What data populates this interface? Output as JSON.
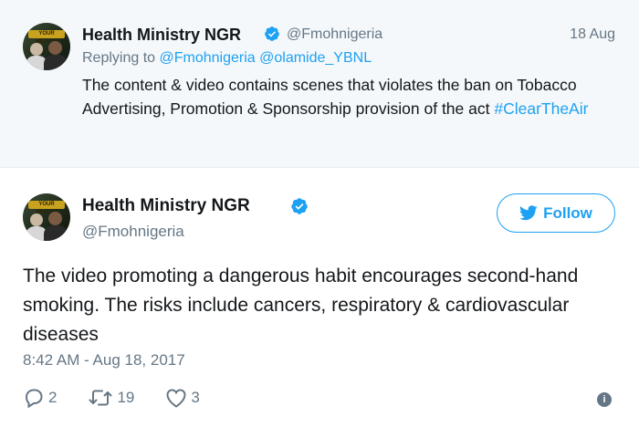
{
  "parent_tweet": {
    "avatar_alt": "Health Ministry NGR avatar",
    "avatar_banner_text": "YOUR HEALTH",
    "name": "Health Ministry NGR",
    "handle": "@Fmohnigeria",
    "date": "18 Aug",
    "replying_label": "Replying to",
    "replying_to": [
      "@Fmohnigeria",
      "@olamide_YBNL"
    ],
    "text_before_tag": "The content & video contains scenes that violates the ban on Tobacco Advertising, Promotion & Sponsorship provision of the act ",
    "hashtag": "#ClearTheAir"
  },
  "main_tweet": {
    "name": "Health Ministry NGR",
    "handle": "@Fmohnigeria",
    "follow_label": "Follow",
    "text": "The video promoting a dangerous habit encourages second-hand smoking. The risks include cancers, respiratory & cardiovascular diseases",
    "timestamp": "8:42 AM - Aug 18, 2017",
    "replies": "2",
    "retweets": "19",
    "likes": "3",
    "info_glyph": "i"
  },
  "colors": {
    "accent": "#1da1f2",
    "muted": "#657786",
    "parent_bg": "#f5f8fa",
    "text": "#14171a"
  },
  "icons": [
    "verified-badge-icon",
    "twitter-bird-icon",
    "reply-icon",
    "retweet-icon",
    "like-icon",
    "info-icon"
  ]
}
